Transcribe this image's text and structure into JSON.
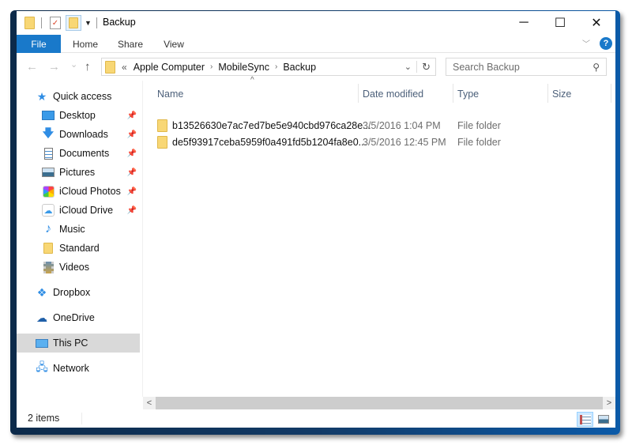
{
  "window": {
    "title": "Backup",
    "controls": {
      "minimize": "─",
      "maximize": "☐",
      "close": "✕"
    }
  },
  "ribbon": {
    "tabs": [
      {
        "label": "File",
        "active": true
      },
      {
        "label": "Home"
      },
      {
        "label": "Share"
      },
      {
        "label": "View"
      }
    ],
    "help_label": "?",
    "accent_color": "#1979ca"
  },
  "navigation": {
    "back": "←",
    "forward": "→",
    "recent": "⌄",
    "up": "↑",
    "overflow": "«",
    "breadcrumb": [
      "Apple Computer",
      "MobileSync",
      "Backup"
    ],
    "search_placeholder": "Search Backup"
  },
  "sidebar": {
    "items": [
      {
        "label": "Quick access",
        "icon": "star-icon",
        "pinned": false
      },
      {
        "label": "Desktop",
        "icon": "desktop-icon",
        "pinned": true
      },
      {
        "label": "Downloads",
        "icon": "download-icon",
        "pinned": true
      },
      {
        "label": "Documents",
        "icon": "document-icon",
        "pinned": true
      },
      {
        "label": "Pictures",
        "icon": "pictures-icon",
        "pinned": true
      },
      {
        "label": "iCloud Photos",
        "icon": "icloud-photos-icon",
        "pinned": true
      },
      {
        "label": "iCloud Drive",
        "icon": "icloud-drive-icon",
        "pinned": true
      },
      {
        "label": "Music",
        "icon": "music-icon",
        "pinned": false
      },
      {
        "label": "Standard",
        "icon": "folder-icon",
        "pinned": false
      },
      {
        "label": "Videos",
        "icon": "videos-icon",
        "pinned": false
      },
      {
        "label": "Dropbox",
        "icon": "dropbox-icon",
        "pinned": false
      },
      {
        "label": "OneDrive",
        "icon": "onedrive-icon",
        "pinned": false
      },
      {
        "label": "This PC",
        "icon": "computer-icon",
        "pinned": false,
        "selected": true
      },
      {
        "label": "Network",
        "icon": "network-icon",
        "pinned": false
      }
    ],
    "pin_glyph": "📌"
  },
  "file_list": {
    "columns": [
      "Name",
      "Date modified",
      "Type",
      "Size"
    ],
    "sort_indicator": "^",
    "rows": [
      {
        "name": "b13526630e7ac7ed7be5e940cbd976ca28e...",
        "date": "3/5/2016 1:04 PM",
        "type": "File folder",
        "size": ""
      },
      {
        "name": "de5f93917ceba5959f0a491fd5b1204fa8e0...",
        "date": "3/5/2016 12:45 PM",
        "type": "File folder",
        "size": ""
      }
    ]
  },
  "status": {
    "item_count": "2 items"
  }
}
